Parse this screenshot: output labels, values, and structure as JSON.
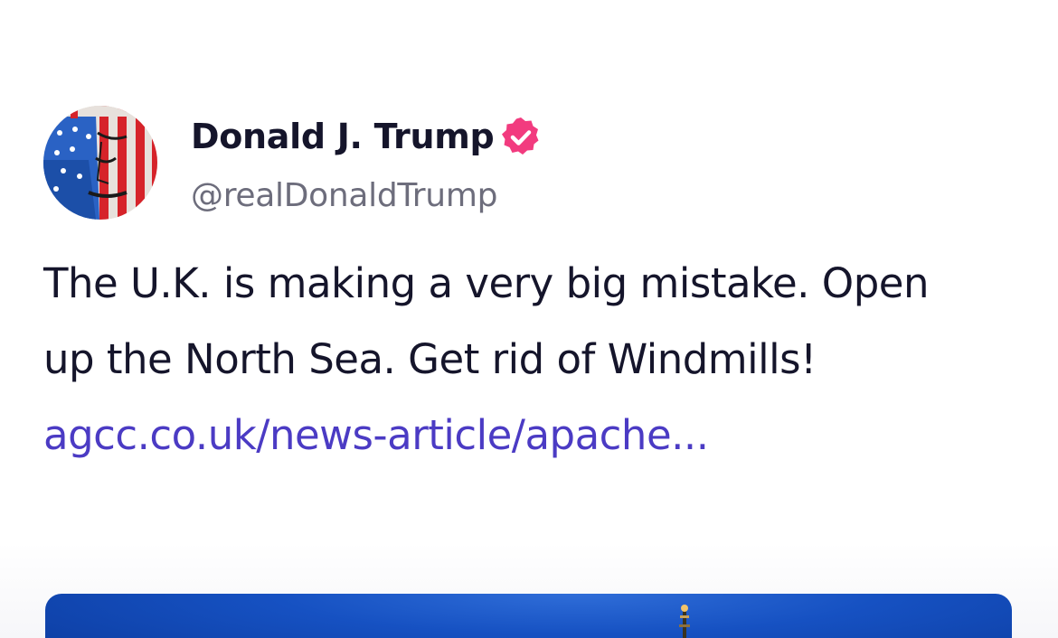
{
  "post": {
    "author": {
      "display_name": "Donald J. Trump",
      "handle": "@realDonaldTrump",
      "verified": true,
      "verified_color": "#f23b7f"
    },
    "text": "The U.K. is making a very big mistake. Open up the North Sea. Get rid of Windmills! ",
    "link_text": "agcc.co.uk/news-article/apache...",
    "link_color": "#4b3bc4",
    "media": {
      "icon": "offshore-rig-image"
    }
  }
}
